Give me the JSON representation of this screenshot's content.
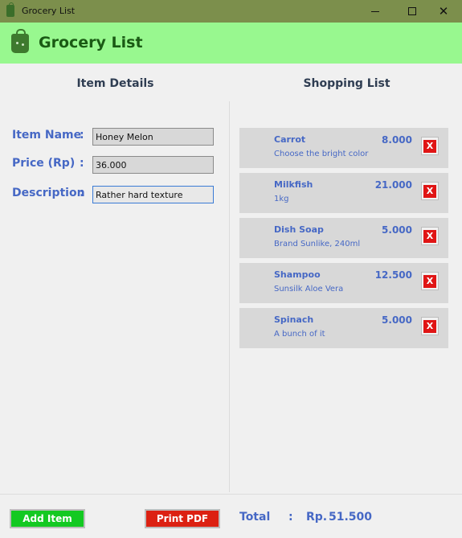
{
  "window": {
    "title": "Grocery List"
  },
  "header": {
    "title": "Grocery List"
  },
  "sections": {
    "left_title": "Item Details",
    "right_title": "Shopping List"
  },
  "form": {
    "item_name_label": "Item Name",
    "price_label": "Price (Rp)",
    "description_label": "Description",
    "colon": ":",
    "item_name_value": "Honey Melon",
    "price_value": "36.000",
    "description_value": "Rather hard texture"
  },
  "shopping_list": {
    "delete_symbol": "X",
    "items": [
      {
        "name": "Carrot",
        "description": "Choose the bright color",
        "price": "8.000"
      },
      {
        "name": "Milkfish",
        "description": "1kg",
        "price": "21.000"
      },
      {
        "name": "Dish Soap",
        "description": "Brand Sunlike, 240ml",
        "price": "5.000"
      },
      {
        "name": "Shampoo",
        "description": "Sunsilk Aloe Vera",
        "price": "12.500"
      },
      {
        "name": "Spinach",
        "description": "A bunch of it",
        "price": "5.000"
      }
    ]
  },
  "buttons": {
    "add_item": "Add Item",
    "print_pdf": "Print PDF"
  },
  "total": {
    "label": "Total",
    "colon": ":",
    "currency": "Rp.",
    "value": "51.500"
  },
  "colors": {
    "title_bar": "#7c8f4c",
    "header_bg": "#98f88f",
    "accent_blue": "#4668c5",
    "add_button": "#13c922",
    "pdf_button": "#dc2112",
    "delete_red": "#e01515"
  },
  "icons": {
    "app_icon": "shopping-bag-icon",
    "header_icon": "shopping-bag-icon",
    "delete_icon": "close-icon"
  }
}
